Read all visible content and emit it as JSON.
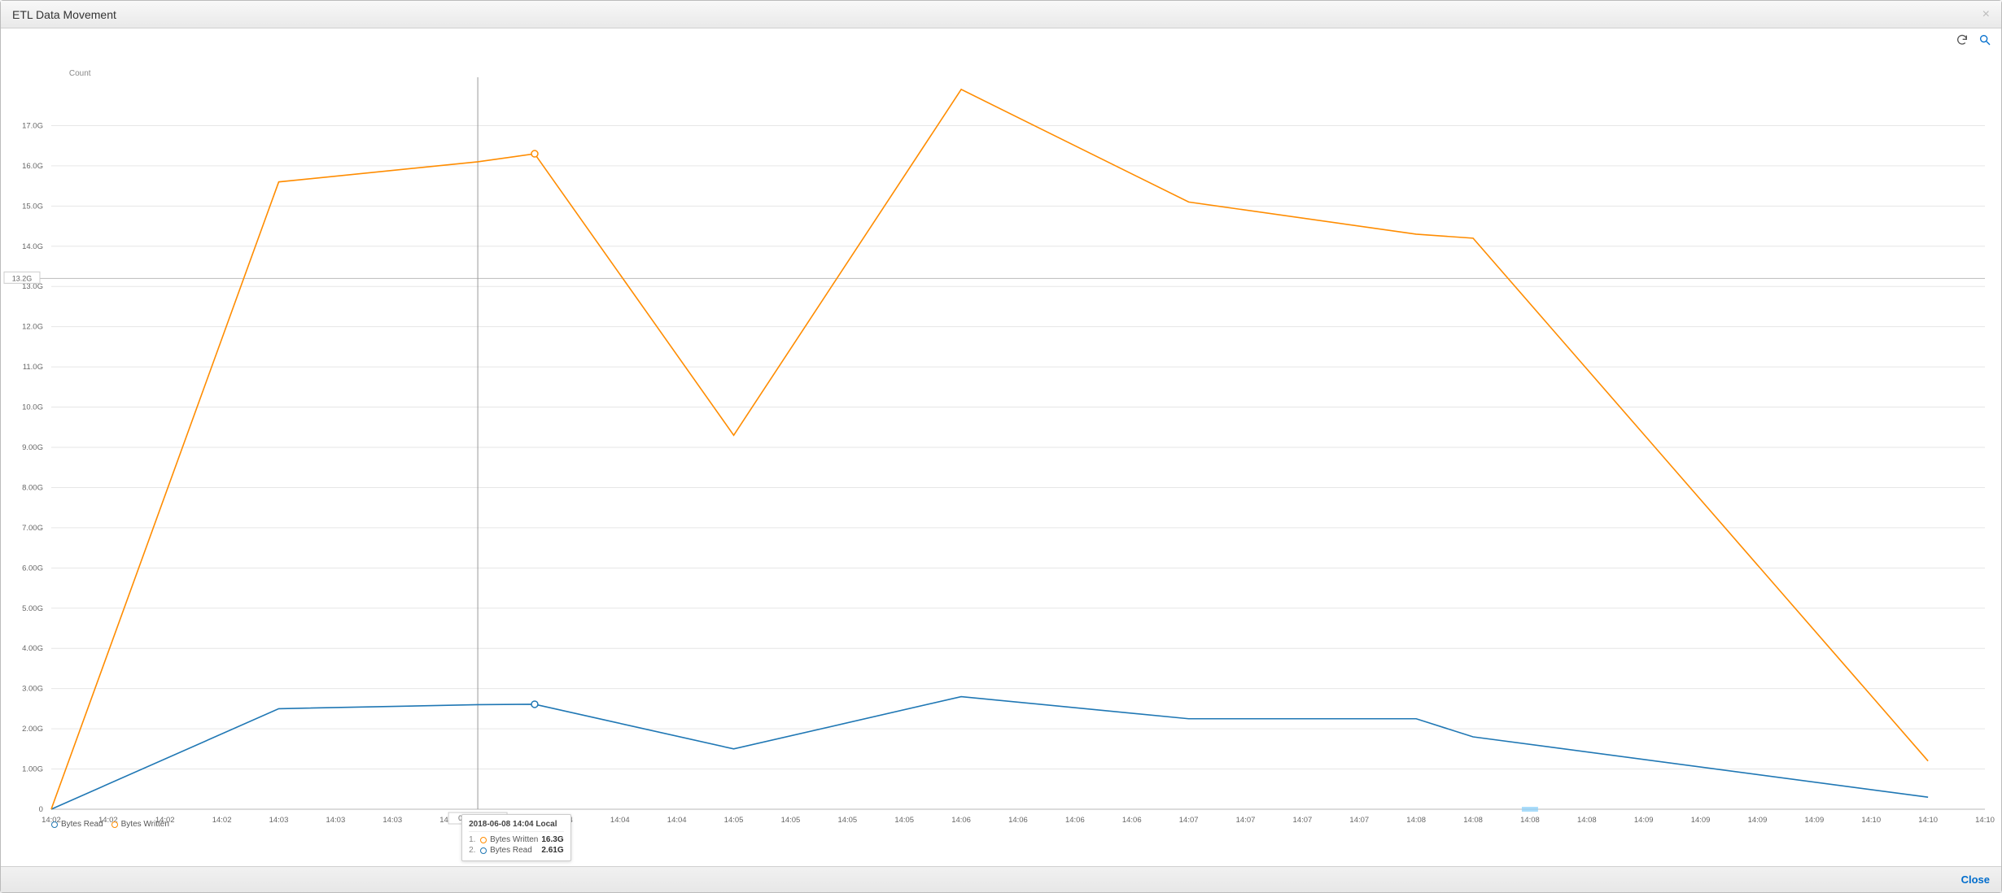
{
  "modal": {
    "title": "ETL Data Movement",
    "close_x": "×",
    "close_button": "Close"
  },
  "toolbar": {
    "refresh_name": "refresh-icon",
    "search_name": "search-icon"
  },
  "legend": {
    "items": [
      {
        "label": "Bytes Read",
        "color": "#1F77B4"
      },
      {
        "label": "Bytes Written",
        "color": "#FF8C00"
      }
    ]
  },
  "tooltip": {
    "title": "2018-06-08 14:04 Local",
    "rows": [
      {
        "idx": "1.",
        "label": "Bytes Written",
        "value": "16.3G",
        "color": "#FF8C00"
      },
      {
        "idx": "2.",
        "label": "Bytes Read",
        "value": "2.61G",
        "color": "#1F77B4"
      }
    ]
  },
  "chart_data": {
    "type": "line",
    "title": "ETL Data Movement",
    "xlabel": "",
    "ylabel": "Count",
    "ylim": [
      0,
      18.0
    ],
    "y_ticks": [
      0,
      1.0,
      2.0,
      3.0,
      4.0,
      5.0,
      6.0,
      7.0,
      8.0,
      9.0,
      10.0,
      11.0,
      12.0,
      13.0,
      14.0,
      15.0,
      16.0,
      17.0
    ],
    "y_tick_labels": [
      "0",
      "1.00G",
      "2.00G",
      "3.00G",
      "4.00G",
      "5.00G",
      "6.00G",
      "7.00G",
      "8.00G",
      "9.00G",
      "10.0G",
      "11.0G",
      "12.0G",
      "13.0G",
      "14.0G",
      "15.0G",
      "16.0G",
      "17.0G"
    ],
    "reference_y": {
      "value": 13.2,
      "label": "13.2G"
    },
    "x_display_ticks": [
      "14:02",
      "14:02",
      "14:02",
      "14:02",
      "14:03",
      "14:03",
      "14:03",
      "14:03",
      "14:04",
      "14:04",
      "14:04",
      "14:04",
      "14:05",
      "14:05",
      "14:05",
      "14:05",
      "14:06",
      "14:06",
      "14:06",
      "14:06",
      "14:07",
      "14:07",
      "14:07",
      "14:07",
      "14:08",
      "14:08",
      "14:08",
      "14:08",
      "14:09",
      "14:09",
      "14:09",
      "14:09",
      "14:10",
      "14:10",
      "14:10"
    ],
    "x_display_count": 35,
    "crosshair_display_index": 7.5,
    "crosshair_tick_label": "06-08 14:03",
    "cursor_band_display_index": 26.0,
    "series": [
      {
        "name": "Bytes Read",
        "color": "#1F77B4",
        "y": [
          0.0,
          2.5,
          2.6,
          2.61,
          1.5,
          2.8,
          2.25,
          2.25,
          1.8,
          0.3
        ]
      },
      {
        "name": "Bytes Written",
        "color": "#FF8C00",
        "y": [
          0.0,
          15.6,
          16.1,
          16.3,
          9.3,
          17.9,
          15.1,
          14.3,
          14.2,
          1.2
        ]
      }
    ],
    "data_x": [
      "14:02",
      "14:03",
      "14:04",
      "14:04",
      "14:05",
      "14:06",
      "14:07",
      "14:08",
      "14:08",
      "14:10"
    ],
    "data_x_display_index": [
      0,
      4,
      7.5,
      8.5,
      12,
      16,
      20,
      24,
      25,
      33
    ],
    "highlight_data_index": 3
  }
}
